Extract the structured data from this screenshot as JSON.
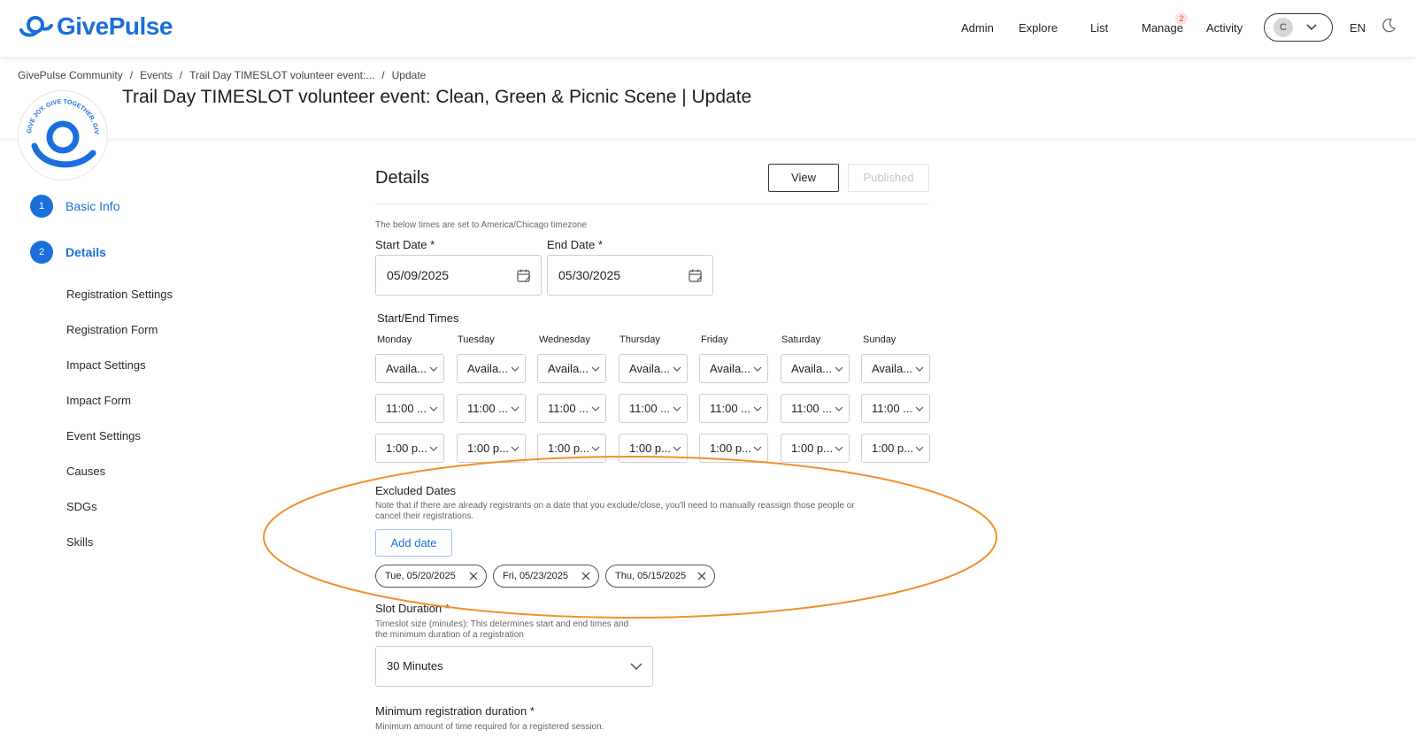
{
  "brand": {
    "name": "GivePulse",
    "accent": "#1a6fdc"
  },
  "nav": {
    "items": [
      "Admin",
      "Explore",
      "List",
      "Manage",
      "Activity"
    ],
    "manage_badge": "2",
    "user_initial": "C",
    "language": "EN"
  },
  "breadcrumb": [
    "GivePulse Community",
    "Events",
    "Trail Day TIMESLOT volunteer event:...",
    "Update"
  ],
  "page_title": "Trail Day TIMESLOT volunteer event: Clean, Green & Picnic Scene | Update",
  "org_logo_text": "GIVE JOY. GIVE TOGETHER. GIVE MORE.",
  "steps": [
    {
      "num": "1",
      "label": "Basic Info"
    },
    {
      "num": "2",
      "label": "Details"
    }
  ],
  "sub_steps": [
    "Registration Settings",
    "Registration Form",
    "Impact Settings",
    "Impact Form",
    "Event Settings",
    "Causes",
    "SDGs",
    "Skills"
  ],
  "details": {
    "title": "Details",
    "view_label": "View",
    "published_label": "Published",
    "timezone_note": "The below times are set to America/Chicago timezone",
    "start_date_label": "Start Date *",
    "start_date_value": "05/09/2025",
    "end_date_label": "End Date *",
    "end_date_value": "05/30/2025",
    "times_label": "Start/End Times",
    "days": [
      {
        "name": "Monday",
        "availability": "Availa...",
        "start": "11:00 ...",
        "end": "1:00 p..."
      },
      {
        "name": "Tuesday",
        "availability": "Availa...",
        "start": "11:00 ...",
        "end": "1:00 p..."
      },
      {
        "name": "Wednesday",
        "availability": "Availa...",
        "start": "11:00 ...",
        "end": "1:00 p..."
      },
      {
        "name": "Thursday",
        "availability": "Availa...",
        "start": "11:00 ...",
        "end": "1:00 p..."
      },
      {
        "name": "Friday",
        "availability": "Availa...",
        "start": "11:00 ...",
        "end": "1:00 p..."
      },
      {
        "name": "Saturday",
        "availability": "Availa...",
        "start": "11:00 ...",
        "end": "1:00 p..."
      },
      {
        "name": "Sunday",
        "availability": "Availa...",
        "start": "11:00 ...",
        "end": "1:00 p..."
      }
    ],
    "excluded_label": "Excluded Dates",
    "excluded_note_1": "Note that if there are already registrants on a date that you exclude/close, you'll need to manually reassign those people or",
    "excluded_note_2": "cancel their registrations.",
    "add_date_label": "Add date",
    "excluded_dates": [
      "Tue, 05/20/2025",
      "Fri, 05/23/2025",
      "Thu, 05/15/2025"
    ],
    "slot_label": "Slot Duration *",
    "slot_note_1": "Timeslot size (minutes): This determines start and end times and",
    "slot_note_2": "the minimum duration of a registration",
    "slot_value": "30 Minutes",
    "min_label": "Minimum registration duration *",
    "min_note": "Minimum amount of time required for a registered session."
  },
  "annotation_color": "#f0902a"
}
